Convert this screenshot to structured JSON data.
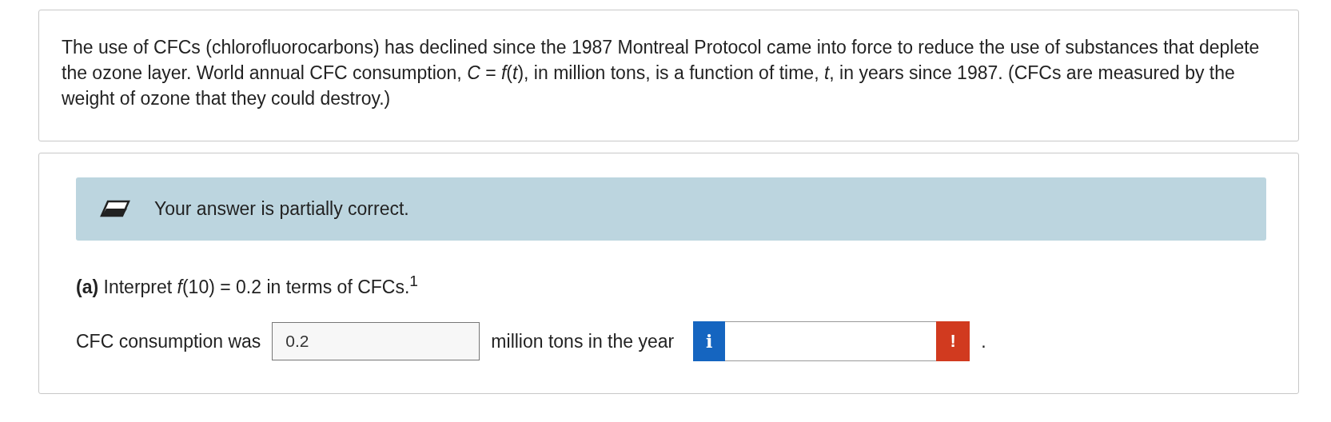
{
  "problem": {
    "text": "The use of CFCs (chlorofluorocarbons) has declined since the 1987 Montreal Protocol came into force to reduce the use of substances that deplete the ozone layer. World annual CFC consumption, *C* = *f*(*t*), in million tons, is a function of time, *t*, in years since 1987. (CFCs are measured by the weight of ozone that they could destroy.)"
  },
  "feedback": {
    "text": "Your answer is partially correct."
  },
  "part_a": {
    "prompt": "**(a)** Interpret *f*(10) = 0.2 in terms of CFCs.$^{1}$",
    "lead": "CFC consumption was",
    "answer_1": {
      "value": "0.2"
    },
    "middle": "million tons in the year",
    "info_button": "i",
    "status_button": "!",
    "end": "."
  }
}
